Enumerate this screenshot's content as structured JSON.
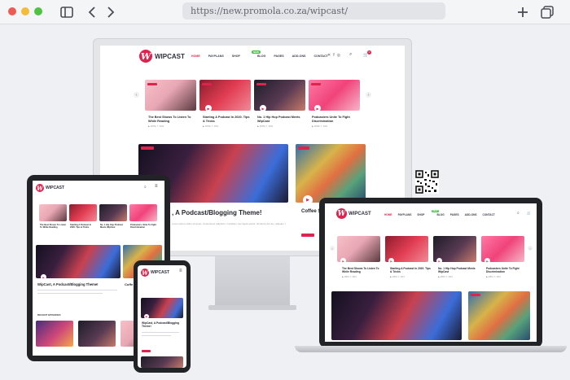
{
  "browser": {
    "url": "https://new.promola.co.za/wipcast/",
    "sidebar_icon": "sidebar-icon",
    "back_icon": "chevron-left-icon",
    "forward_icon": "chevron-right-icon",
    "new_tab_icon": "plus-icon",
    "tabs_icon": "tabs-overview-icon"
  },
  "site": {
    "logo_mark": "W",
    "logo_text": "WIPCAST",
    "menu": [
      "HOME",
      "PAYPLANS",
      "SHOP",
      "BLOG",
      "PAGES",
      "ADD-ONS",
      "CONTACT"
    ],
    "new_badge": "NEW",
    "cart_count": "0",
    "brand_color": "#e0224e",
    "carousel": [
      {
        "title": "The Best Shows To Listen To While Reading",
        "meta": "▶ APRIL 7, 2021"
      },
      {
        "title": "Starting A Podcast In 2020. Tips & Tricks",
        "meta": "▶ APRIL 7, 2021"
      },
      {
        "title": "No. 1 Hip Hop Podcast Meets WipCast",
        "meta": "▶ APRIL 7, 2021"
      },
      {
        "title": "Podcasters Unite To Fight Discrimination",
        "meta": "▶ APRIL 7, 2021"
      }
    ],
    "hero_title": "WipCast, A Podcast/Blogging Theme!",
    "hero_title_partial": ", A Podcast/Blogging Theme!",
    "hero_excerpt": "Lorem ipsum dolor sit amet, consectetur adipiscin. Curabitur nec ligula auctor, tincidunt dui nec, aliquam nisim. Dolor",
    "side_title": "Coffee Shows",
    "side_title_partial": "Coffee S",
    "side_title_tablet": "Coffe Show",
    "recent_heading": "RECENT EPISODES",
    "mobile_hero_title": "WipCast, A Podcast/Blogging Theme!",
    "read_more": "READ MORE"
  }
}
